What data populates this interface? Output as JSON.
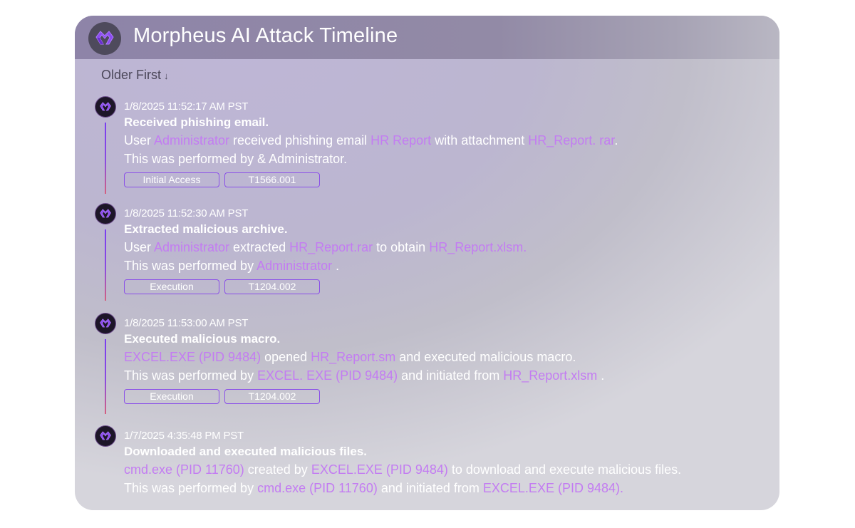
{
  "header": {
    "title": "Morpheus AI Attack Timeline",
    "logo_icon": "morpheus-m-logo-icon"
  },
  "sort": {
    "label": "Older First",
    "arrow": "↓",
    "arrow_icon": "arrow-down-icon"
  },
  "colors": {
    "accent": "#c37cf2",
    "tag_border": "#8a4fe8",
    "header_bg": "#8e84a8",
    "timeline_top": "#7a3df0",
    "timeline_bottom": "#d4607e"
  },
  "events": [
    {
      "timestamp": "1/8/2025 11:52:17 AM PST",
      "title": "Received phishing email.",
      "line1": [
        {
          "t": "User ",
          "hl": false
        },
        {
          "t": "Administrator",
          "hl": true
        },
        {
          "t": " received phishing email ",
          "hl": false
        },
        {
          "t": "HR Report",
          "hl": true
        },
        {
          "t": " with attachment  ",
          "hl": false
        },
        {
          "t": "HR_Report. rar",
          "hl": true
        },
        {
          "t": ".",
          "hl": false
        }
      ],
      "line2": [
        {
          "t": "This was performed by & Administrator.",
          "hl": false
        }
      ],
      "tags": [
        "Initial Access",
        "T1566.001"
      ]
    },
    {
      "timestamp": "1/8/2025 11:52:30 AM PST",
      "title": "Extracted malicious archive.",
      "line1": [
        {
          "t": "User ",
          "hl": false
        },
        {
          "t": "Administrator",
          "hl": true
        },
        {
          "t": " extracted ",
          "hl": false
        },
        {
          "t": "HR_Report.rar",
          "hl": true
        },
        {
          "t": " to obtain ",
          "hl": false
        },
        {
          "t": "HR_Report.xlsm.",
          "hl": true
        }
      ],
      "line2": [
        {
          "t": "This was performed by ",
          "hl": false
        },
        {
          "t": "Administrator",
          "hl": true
        },
        {
          "t": " .",
          "hl": false
        }
      ],
      "tags": [
        "Execution",
        "T1204.002"
      ]
    },
    {
      "timestamp": "1/8/2025 11:53:00 AM PST",
      "title": "Executed malicious macro.",
      "line1": [
        {
          "t": "EXCEL.EXE (PID 9484)",
          "hl": true
        },
        {
          "t": " opened ",
          "hl": false
        },
        {
          "t": "HR_Report.sm",
          "hl": true
        },
        {
          "t": " and executed malicious macro.",
          "hl": false
        }
      ],
      "line2": [
        {
          "t": "This was performed by ",
          "hl": false
        },
        {
          "t": "EXCEL. EXE (PID 9484)",
          "hl": true
        },
        {
          "t": " and initiated from ",
          "hl": false
        },
        {
          "t": "HR_Report.xlsm",
          "hl": true
        },
        {
          "t": " .",
          "hl": false
        }
      ],
      "tags": [
        "Execution",
        "T1204.002"
      ]
    },
    {
      "timestamp": "1/7/2025 4:35:48 PM PST",
      "title": "Downloaded and executed malicious files.",
      "line1": [
        {
          "t": "cmd.exe (PID 11760)",
          "hl": true
        },
        {
          "t": " created by ",
          "hl": false
        },
        {
          "t": "EXCEL.EXE (PID 9484)",
          "hl": true
        },
        {
          "t": " to download and execute malicious files.",
          "hl": false
        }
      ],
      "line2": [
        {
          "t": "This was performed by ",
          "hl": false
        },
        {
          "t": "cmd.exe (PID 11760)",
          "hl": true
        },
        {
          "t": " and initiated from ",
          "hl": false
        },
        {
          "t": "EXCEL.EXE (PID 9484).",
          "hl": true
        }
      ],
      "tags": []
    }
  ]
}
